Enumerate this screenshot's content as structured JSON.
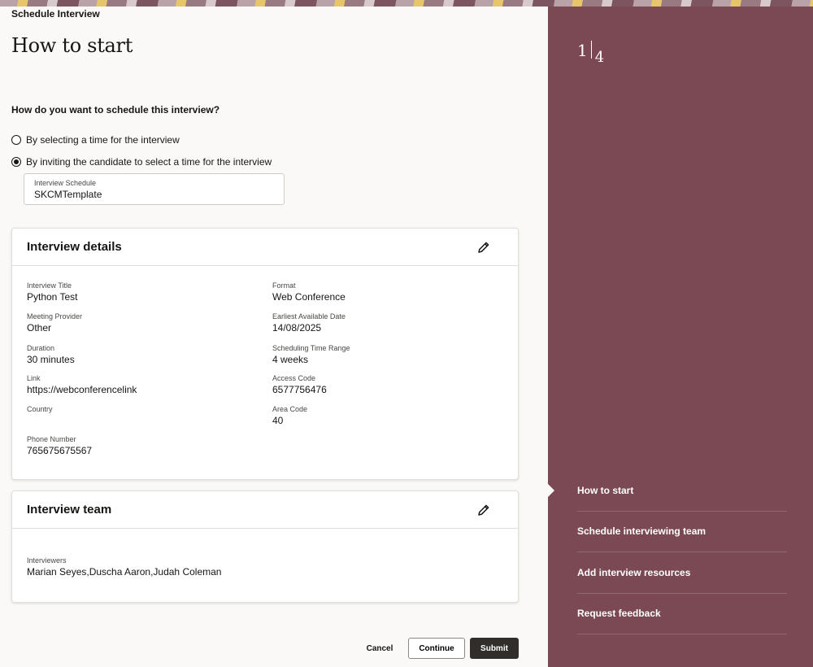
{
  "header": {
    "breadcrumb": "Schedule Interview",
    "title": "How to start"
  },
  "question": "How do you want to schedule this interview?",
  "options": [
    {
      "label": "By selecting a time for the interview",
      "checked": false
    },
    {
      "label": "By inviting the candidate to select a time for the interview",
      "checked": true
    }
  ],
  "schedule_field": {
    "label": "Interview Schedule",
    "value": "SKCMTemplate"
  },
  "details_card": {
    "title": "Interview details",
    "fields": {
      "interview_title": {
        "label": "Interview Title",
        "value": "Python Test"
      },
      "format": {
        "label": "Format",
        "value": "Web Conference"
      },
      "meeting_provider": {
        "label": "Meeting Provider",
        "value": "Other"
      },
      "earliest_date": {
        "label": "Earliest Available Date",
        "value": "14/08/2025"
      },
      "duration": {
        "label": "Duration",
        "value": "30 minutes"
      },
      "time_range": {
        "label": "Scheduling Time Range",
        "value": "4 weeks"
      },
      "link": {
        "label": "Link",
        "value": "https://webconferencelink"
      },
      "access_code": {
        "label": "Access Code",
        "value": "6577756476"
      },
      "country": {
        "label": "Country",
        "value": ""
      },
      "area_code": {
        "label": "Area Code",
        "value": "40"
      },
      "phone": {
        "label": "Phone Number",
        "value": "765675675567"
      }
    }
  },
  "team_card": {
    "title": "Interview team",
    "interviewers_label": "Interviewers",
    "interviewers_value": "Marian Seyes,Duscha Aaron,Judah Coleman"
  },
  "footer": {
    "cancel": "Cancel",
    "continue": "Continue",
    "submit": "Submit"
  },
  "side": {
    "current_step": "1",
    "total_steps": "4",
    "steps": [
      "How to start",
      "Schedule interviewing team",
      "Add interview resources",
      "Request feedback"
    ],
    "bg_color": "#7b4953"
  }
}
